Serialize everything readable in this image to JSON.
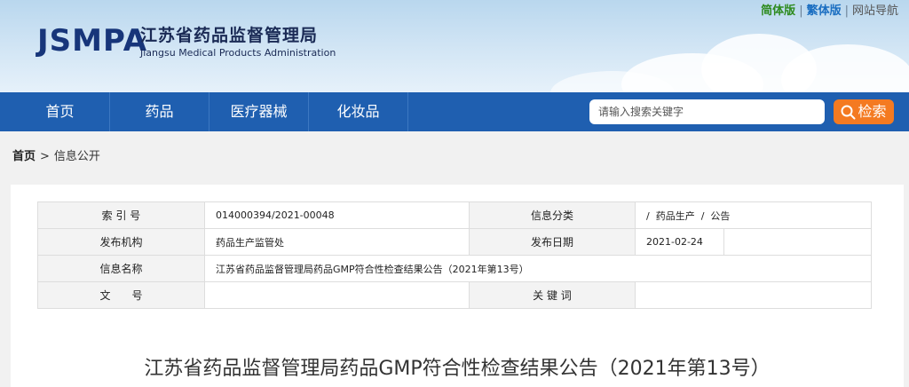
{
  "header": {
    "logo_mark": "JSMPA",
    "title_cn": "江苏省药品监督管理局",
    "title_en": "Jiangsu Medical Products Administration",
    "links": {
      "simplified": "简体版",
      "traditional": "繁体版",
      "site_nav": "网站导航",
      "sep": "|"
    }
  },
  "nav": {
    "items": [
      "首页",
      "药品",
      "医疗器械",
      "化妆品"
    ],
    "search_placeholder": "请输入搜索关键字",
    "search_label": "检索"
  },
  "breadcrumb": {
    "home": "首页",
    "sep": ">",
    "current": "信息公开"
  },
  "meta": {
    "index_label": "索 引 号",
    "index_value": "014000394/2021-00048",
    "category_label": "信息分类",
    "category_value": "/  药品生产  /  公告",
    "publisher_label": "发布机构",
    "publisher_value": "药品生产监管处",
    "date_label": "发布日期",
    "date_value": "2021-02-24",
    "name_label": "信息名称",
    "name_value": "江苏省药品监督管理局药品GMP符合性检查结果公告（2021年第13号）",
    "doc_label": "文　　号",
    "doc_value": "",
    "keywords_label": "关 键 词",
    "keywords_value": ""
  },
  "article": {
    "title": "江苏省药品监督管理局药品GMP符合性检查结果公告（2021年第13号）"
  },
  "colors": {
    "nav_bg": "#1f5fb0",
    "search_btn": "#f47a21",
    "logo": "#17357a"
  }
}
